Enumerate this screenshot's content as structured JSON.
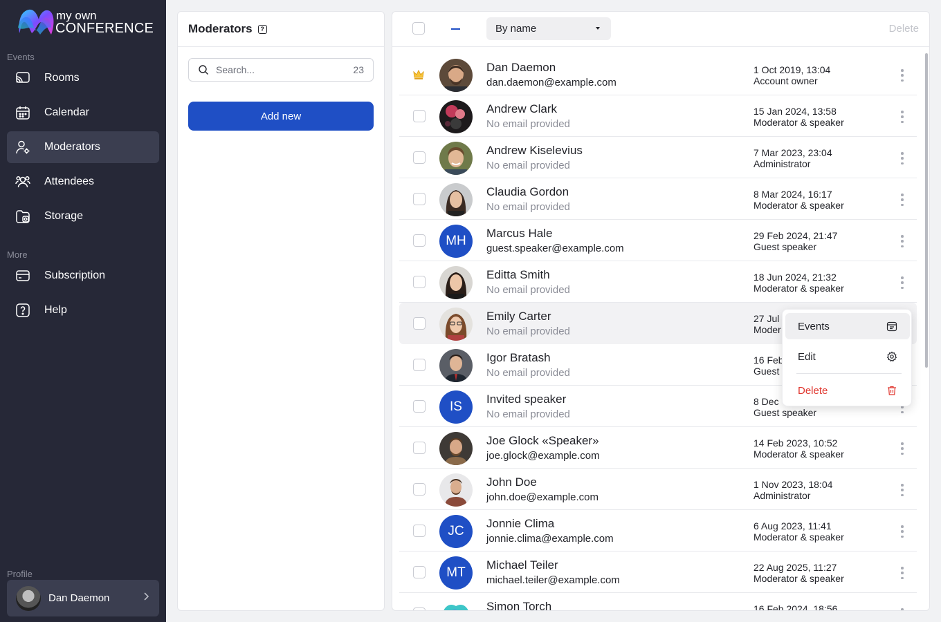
{
  "logo": {
    "line1": "my own",
    "line2": "CONFERENCE"
  },
  "sidebar": {
    "events_label": "Events",
    "more_label": "More",
    "profile_label": "Profile",
    "items": [
      {
        "label": "Rooms",
        "icon": "cast-icon"
      },
      {
        "label": "Calendar",
        "icon": "calendar-icon"
      },
      {
        "label": "Moderators",
        "icon": "user-gear-icon",
        "active": true
      },
      {
        "label": "Attendees",
        "icon": "users-icon"
      },
      {
        "label": "Storage",
        "icon": "folder-icon"
      },
      {
        "label": "Subscription",
        "icon": "card-icon"
      },
      {
        "label": "Help",
        "icon": "help-icon"
      }
    ],
    "profile_name": "Dan Daemon"
  },
  "moderators_panel": {
    "title": "Moderators",
    "search_placeholder": "Search...",
    "count": "23",
    "add_button": "Add new"
  },
  "toolbar": {
    "sort_value": "By name",
    "delete_label": "Delete"
  },
  "rows": [
    {
      "name": "Dan Daemon",
      "email": "dan.daemon@example.com",
      "date": "1 Oct 2019, 13:04",
      "role": "Account owner"
    },
    {
      "name": "Andrew Clark",
      "email": "No email provided",
      "date": "15 Jan 2024, 13:58",
      "role": "Moderator & speaker"
    },
    {
      "name": "Andrew Kiselevius",
      "email": "No email provided",
      "date": "7 Mar 2023, 23:04",
      "role": "Administrator"
    },
    {
      "name": "Claudia Gordon",
      "email": "No email provided",
      "date": "8 Mar 2024, 16:17",
      "role": "Moderator & speaker"
    },
    {
      "name": "Marcus Hale",
      "initials": "MH",
      "email": "guest.speaker@example.com",
      "date": "29 Feb 2024, 21:47",
      "role": "Guest speaker"
    },
    {
      "name": "Editta Smith",
      "email": "No email provided",
      "date": "18 Jun 2024, 21:32",
      "role": "Moderator & speaker"
    },
    {
      "name": "Emily Carter",
      "email": "No email provided",
      "date": "27 Jul",
      "role": "Moder"
    },
    {
      "name": "Igor Bratash",
      "email": "No email provided",
      "date": "16 Feb",
      "role": "Guest"
    },
    {
      "name": "Invited speaker",
      "initials": "IS",
      "email": "No email provided",
      "date": "8 Dec",
      "role": "Guest speaker"
    },
    {
      "name": "Joe Glock «Speaker»",
      "email": "joe.glock@example.com",
      "date": "14 Feb 2023, 10:52",
      "role": "Moderator & speaker"
    },
    {
      "name": "John Doe",
      "email": "john.doe@example.com",
      "date": "1 Nov 2023, 18:04",
      "role": "Administrator"
    },
    {
      "name": "Jonnie Clima",
      "initials": "JC",
      "email": "jonnie.clima@example.com",
      "date": "6 Aug 2023, 11:41",
      "role": "Moderator & speaker"
    },
    {
      "name": "Michael Teiler",
      "initials": "MT",
      "email": "michael.teiler@example.com",
      "date": "22 Aug 2025, 11:27",
      "role": "Moderator & speaker"
    },
    {
      "name": "Simon Torch",
      "email": "",
      "date": "16 Feb 2024, 18:56",
      "role": ""
    }
  ],
  "context_menu": {
    "events": "Events",
    "edit": "Edit",
    "delete": "Delete"
  },
  "colors": {
    "sidebar_bg": "#262837",
    "accent": "#1f4fc5",
    "danger": "#e0362e"
  }
}
